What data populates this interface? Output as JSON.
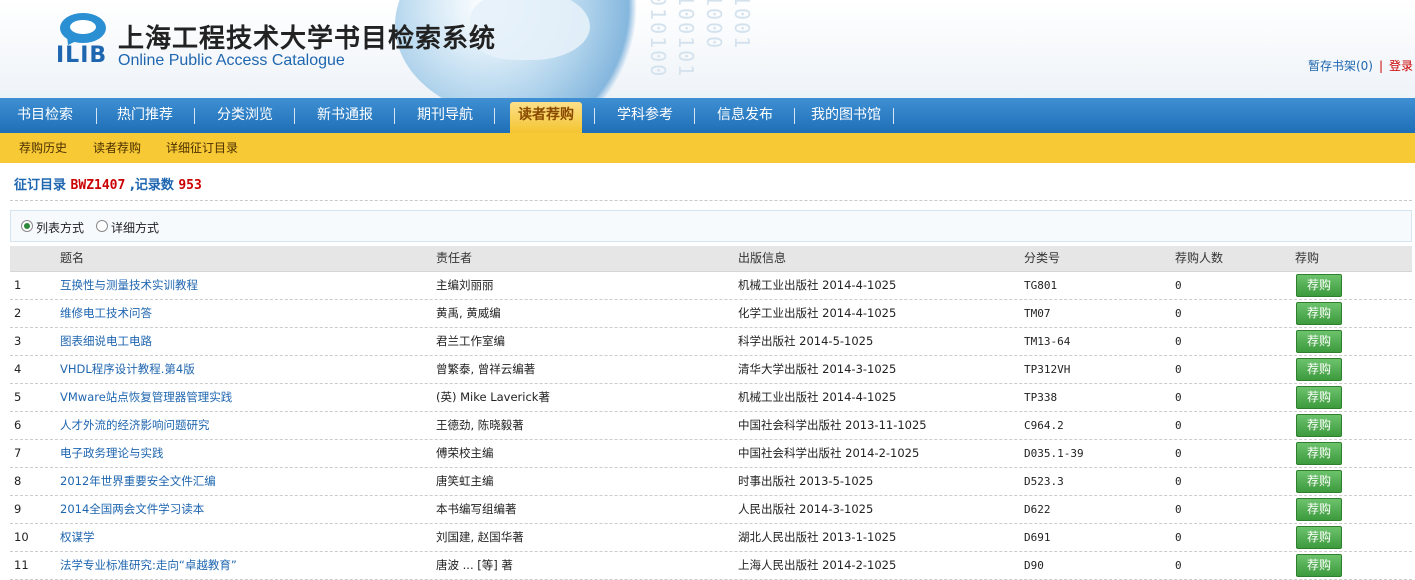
{
  "header": {
    "logo_text": "ILIB",
    "title": "上海工程技术大学书目检索系统",
    "subtitle": "Online Public Access Catalogue",
    "shelf_link": "暂存书架(0)",
    "separator": "|",
    "login_link": "登录"
  },
  "nav": {
    "items": [
      "书目检索",
      "热门推荐",
      "分类浏览",
      "新书通报",
      "期刊导航",
      "读者荐购",
      "学科参考",
      "信息发布",
      "我的图书馆"
    ],
    "active_index": 5
  },
  "subnav": {
    "items": [
      "荐购历史",
      "读者荐购",
      "详细征订目录"
    ]
  },
  "catalog": {
    "label": "征订目录",
    "code": "BWZ1407",
    "count_label": ",记录数",
    "count": "953"
  },
  "view_mode": {
    "options": [
      "列表方式",
      "详细方式"
    ],
    "selected": "列表方式"
  },
  "table": {
    "headers": [
      "",
      "题名",
      "责任者",
      "出版信息",
      "分类号",
      "荐购人数",
      "荐购"
    ],
    "button_label": "荐购",
    "rows": [
      {
        "no": "1",
        "title": "互换性与测量技术实训教程",
        "author": "主编刘丽丽",
        "pub": "机械工业出版社 2014-4-1025",
        "class": "TG801",
        "count": "0"
      },
      {
        "no": "2",
        "title": "维修电工技术问答",
        "author": "黄禹, 黄威编",
        "pub": "化学工业出版社 2014-4-1025",
        "class": "TM07",
        "count": "0"
      },
      {
        "no": "3",
        "title": "图表细说电工电路",
        "author": "君兰工作室编",
        "pub": "科学出版社 2014-5-1025",
        "class": "TM13-64",
        "count": "0"
      },
      {
        "no": "4",
        "title": "VHDL程序设计教程.第4版",
        "author": "曾繁泰, 曾祥云编著",
        "pub": "清华大学出版社 2014-3-1025",
        "class": "TP312VH",
        "count": "0"
      },
      {
        "no": "5",
        "title": "VMware站点恢复管理器管理实践",
        "author": "(英) Mike Laverick著",
        "pub": "机械工业出版社 2014-4-1025",
        "class": "TP338",
        "count": "0"
      },
      {
        "no": "6",
        "title": "人才外流的经济影响问题研究",
        "author": "王德劲, 陈晓毅著",
        "pub": "中国社会科学出版社 2013-11-1025",
        "class": "C964.2",
        "count": "0"
      },
      {
        "no": "7",
        "title": "电子政务理论与实践",
        "author": "傅荣校主编",
        "pub": "中国社会科学出版社 2014-2-1025",
        "class": "D035.1-39",
        "count": "0"
      },
      {
        "no": "8",
        "title": "2012年世界重要安全文件汇编",
        "author": "唐笑虹主编",
        "pub": "时事出版社 2013-5-1025",
        "class": "D523.3",
        "count": "0"
      },
      {
        "no": "9",
        "title": "2014全国两会文件学习读本",
        "author": "本书编写组编著",
        "pub": "人民出版社 2014-3-1025",
        "class": "D622",
        "count": "0"
      },
      {
        "no": "10",
        "title": "权谋学",
        "author": "刘国建, 赵国华著",
        "pub": "湖北人民出版社 2013-1-1025",
        "class": "D691",
        "count": "0"
      },
      {
        "no": "11",
        "title": "法学专业标准研究:走向“卓越教育”",
        "author": "唐波 ... [等] 著",
        "pub": "上海人民出版社 2014-2-1025",
        "class": "D90",
        "count": "0"
      }
    ]
  },
  "colors": {
    "nav_blue": "#1f6fb8",
    "subnav_yellow": "#f7c934",
    "link_blue": "#1f66b0",
    "accent_red": "#cc0000",
    "button_green": "#3d9a3d"
  }
}
